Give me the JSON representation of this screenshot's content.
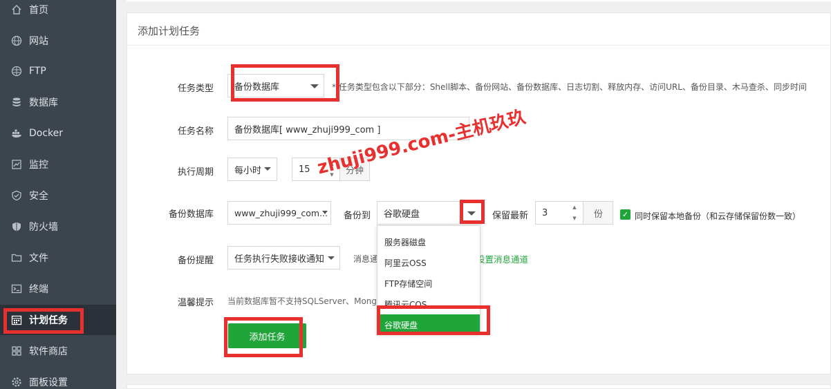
{
  "sidebar": {
    "items": [
      {
        "label": "首页",
        "icon": "home-icon"
      },
      {
        "label": "网站",
        "icon": "globe-icon"
      },
      {
        "label": "FTP",
        "icon": "ftp-globe-icon"
      },
      {
        "label": "数据库",
        "icon": "database-icon"
      },
      {
        "label": "Docker",
        "icon": "docker-icon"
      },
      {
        "label": "监控",
        "icon": "monitor-icon"
      },
      {
        "label": "安全",
        "icon": "shield-check-icon"
      },
      {
        "label": "防火墙",
        "icon": "firewall-shield-icon"
      },
      {
        "label": "文件",
        "icon": "folder-icon"
      },
      {
        "label": "终端",
        "icon": "terminal-icon"
      },
      {
        "label": "计划任务",
        "icon": "calendar-icon",
        "active": true
      },
      {
        "label": "软件商店",
        "icon": "grid-apps-icon"
      },
      {
        "label": "面板设置",
        "icon": "gear-icon"
      }
    ]
  },
  "card": {
    "title": "添加计划任务"
  },
  "form": {
    "task_type": {
      "label": "任务类型",
      "value": "备份数据库",
      "hint": "* 任务类型包含以下部分：Shell脚本、备份网站、备份数据库、日志切割、释放内存、访问URL、备份目录、木马查杀、同步时间"
    },
    "task_name": {
      "label": "任务名称",
      "value": "备份数据库[ www_zhuji999_com ]"
    },
    "period": {
      "label": "执行周期",
      "unit_value": "每小时",
      "number": "15",
      "suffix": "分钟"
    },
    "backup_db": {
      "label": "备份数据库",
      "value": "www_zhuji999_com..."
    },
    "backup_to": {
      "label": "备份到",
      "value": "谷歌硬盘"
    },
    "keep": {
      "label": "保留最新",
      "number": "3",
      "suffix": "份"
    },
    "keep_local": {
      "label": "同时保留本地备份（和云存储保留份数一致）",
      "checked": true
    },
    "notify": {
      "label": "备份提醒",
      "value": "任务执行失败接收通知",
      "channel_prefix": "消息通",
      "channel_link": "设置消息通道"
    },
    "tip": {
      "label": "温馨提示",
      "text": "当前数据库暂不支持SQLServer、Mongo"
    },
    "submit_label": "添加任务"
  },
  "dropdown": {
    "options": [
      "服务器磁盘",
      "阿里云OSS",
      "FTP存储空间",
      "腾讯云COS",
      "谷歌硬盘"
    ],
    "selected": "谷歌硬盘"
  },
  "watermark": "zhuji999.com-主机玖玖",
  "colors": {
    "accent": "#20a53a",
    "highlight": "#e8302f",
    "sidebar": "#3c444d"
  }
}
